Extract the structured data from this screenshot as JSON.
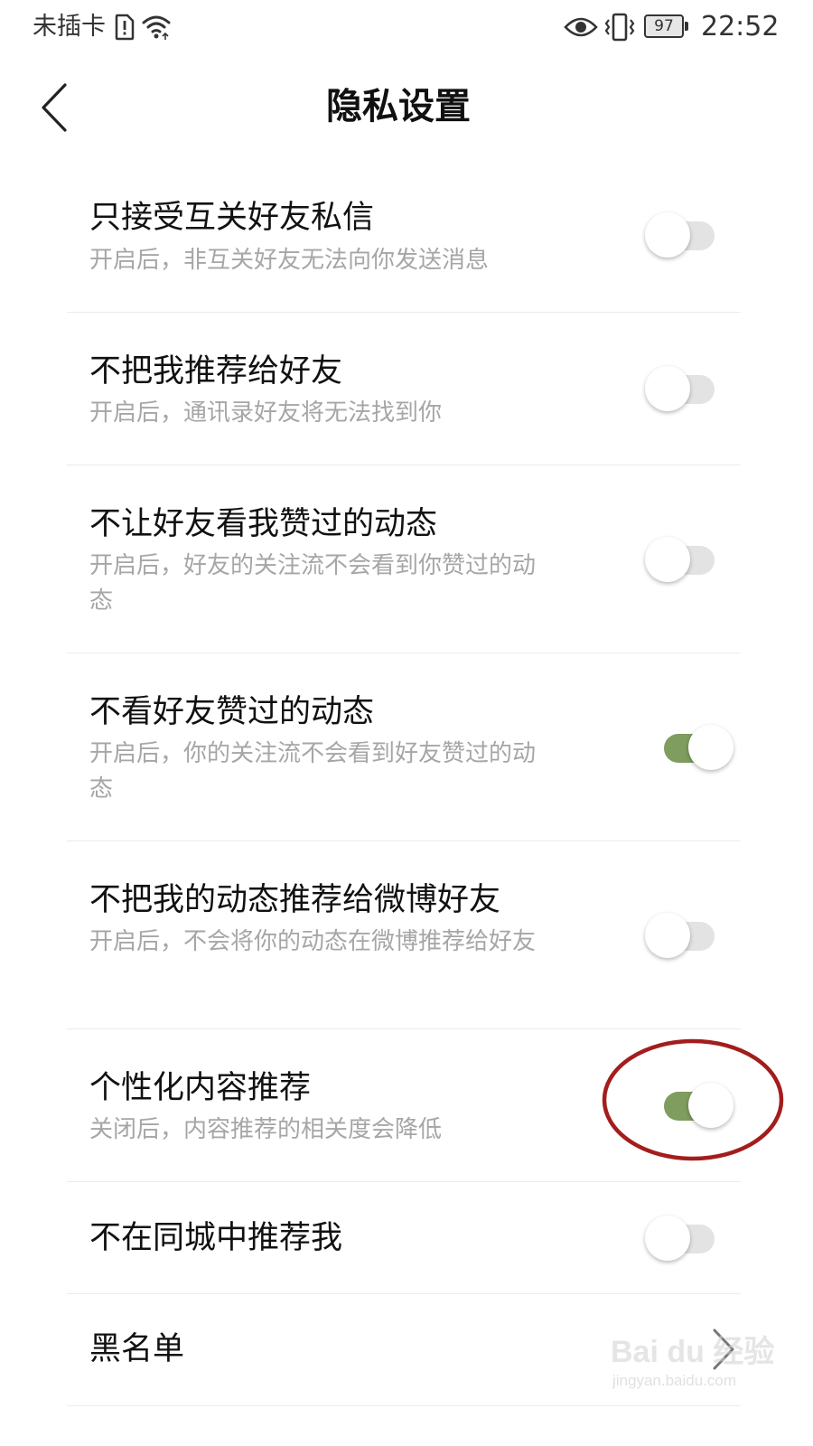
{
  "status_bar": {
    "carrier": "未插卡",
    "battery": "97",
    "time": "22:52",
    "icons": [
      "sim-alert-icon",
      "wifi-icon",
      "eye-icon",
      "vibrate-icon",
      "battery-icon"
    ]
  },
  "header": {
    "title": "隐私设置",
    "back_icon": "chevron-left-icon"
  },
  "settings": [
    {
      "title": "只接受互关好友私信",
      "desc": "开启后，非互关好友无法向你发送消息",
      "enabled": false
    },
    {
      "title": "不把我推荐给好友",
      "desc": "开启后，通讯录好友将无法找到你",
      "enabled": false
    },
    {
      "title": "不让好友看我赞过的动态",
      "desc": "开启后，好友的关注流不会看到你赞过的动态",
      "enabled": false
    },
    {
      "title": "不看好友赞过的动态",
      "desc": "开启后，你的关注流不会看到好友赞过的动态",
      "enabled": true
    },
    {
      "title": "不把我的动态推荐给微博好友",
      "desc": "开启后，不会将你的动态在微博推荐给好友",
      "enabled": false
    },
    {
      "title": "个性化内容推荐",
      "desc": "关闭后，内容推荐的相关度会降低",
      "enabled": true
    },
    {
      "title": "不在同城中推荐我",
      "enabled": false
    }
  ],
  "blacklist": {
    "title": "黑名单",
    "icon": "chevron-right-icon"
  },
  "watermark": {
    "main": "Bai du 经验",
    "sub": "jingyan.baidu.com"
  },
  "colors": {
    "toggle_on": "#7e9d5e",
    "toggle_off": "#e3e3e3",
    "annotation": "#a31d1d",
    "desc_text": "#a6a6a6"
  }
}
